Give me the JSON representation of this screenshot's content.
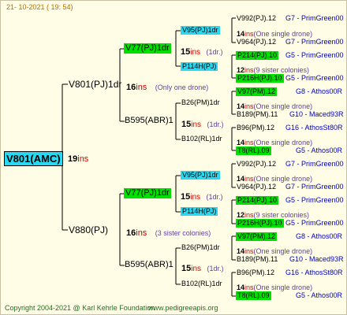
{
  "header": {
    "date": "21- 10-2021 ( 19: 54)"
  },
  "footer": {
    "copyright": "Copyright 2004-2021 @ Karl Kehrle Foundation",
    "site": "www.pedigreeapis.org"
  },
  "root": {
    "name": "V801(AMC)",
    "gen": "19",
    "ins": "ins"
  },
  "sire": {
    "name": "V801(PJ)1dr",
    "gen": "16",
    "ins": "ins",
    "note": "(Only one drone)",
    "s": {
      "name": "V77(PJ)1dr",
      "gen": "15",
      "ins": "ins",
      "note": "(1dr.)",
      "s": {
        "name": "V95(PJ)1dr",
        "gen": "14",
        "ins": "ins",
        "note": "(One single drone)",
        "l1": "V992(PJ).12",
        "r1": "G7 - PrimGreen00",
        "l2": "V964(PJ).12",
        "r2": "G7 - PrimGreen00"
      },
      "d": {
        "name": "P114H(PJ)",
        "gen": "12",
        "ins": "ins",
        "note": "(9 sister colonies)",
        "l1": "P214(PJ).10",
        "r1": "G5 - PrimGreen00",
        "l2": "P216H(PJ).10",
        "r2": "G5 - PrimGreen00"
      }
    },
    "d": {
      "name": "B595(ABR)1",
      "gen": "15",
      "ins": "ins",
      "note": "(1dr.)",
      "s": {
        "name": "B26(PM)1dr",
        "gen": "14",
        "ins": "ins",
        "note": "(One single drone)",
        "l1": "V97(PM).12",
        "r1": "G8 - Athos00R",
        "l2": "B189(PM).11",
        "r2": "G10 - Maced93R"
      },
      "d": {
        "name": "B102(RL)1dr",
        "gen": "14",
        "ins": "ins",
        "note": "(One single drone)",
        "l1": "B96(PM).12",
        "r1": "G16 - AthosSt80R",
        "l2": "T8(RL).09",
        "r2": "G5 - Athos00R"
      }
    }
  },
  "dam": {
    "name": "V880(PJ)",
    "gen": "16",
    "ins": "ins",
    "note": "(3 sister colonies)",
    "s": {
      "name": "V77(PJ)1dr",
      "gen": "15",
      "ins": "ins",
      "note": "(1dr.)",
      "s": {
        "name": "V95(PJ)1dr",
        "gen": "14",
        "ins": "ins",
        "note": "(One single drone)",
        "l1": "V992(PJ).12",
        "r1": "G7 - PrimGreen00",
        "l2": "V964(PJ).12",
        "r2": "G7 - PrimGreen00"
      },
      "d": {
        "name": "P114H(PJ)",
        "gen": "12",
        "ins": "ins",
        "note": "(9 sister colonies)",
        "l1": "P214(PJ).10",
        "r1": "G5 - PrimGreen00",
        "l2": "P216H(PJ).10",
        "r2": "G5 - PrimGreen00"
      }
    },
    "d": {
      "name": "B595(ABR)1",
      "gen": "15",
      "ins": "ins",
      "note": "(1dr.)",
      "s": {
        "name": "B26(PM)1dr",
        "gen": "14",
        "ins": "ins",
        "note": "(One single drone)",
        "l1": "V97(PM).12",
        "r1": "G8 - Athos00R",
        "l2": "B189(PM).11",
        "r2": "G10 - Maced93R"
      },
      "d": {
        "name": "B102(RL)1dr",
        "gen": "14",
        "ins": "ins",
        "note": "(One single drone)",
        "l1": "B96(PM).12",
        "r1": "G16 - AthosSt80R",
        "l2": "T8(RL).09",
        "r2": "G5 - Athos00R"
      }
    }
  }
}
